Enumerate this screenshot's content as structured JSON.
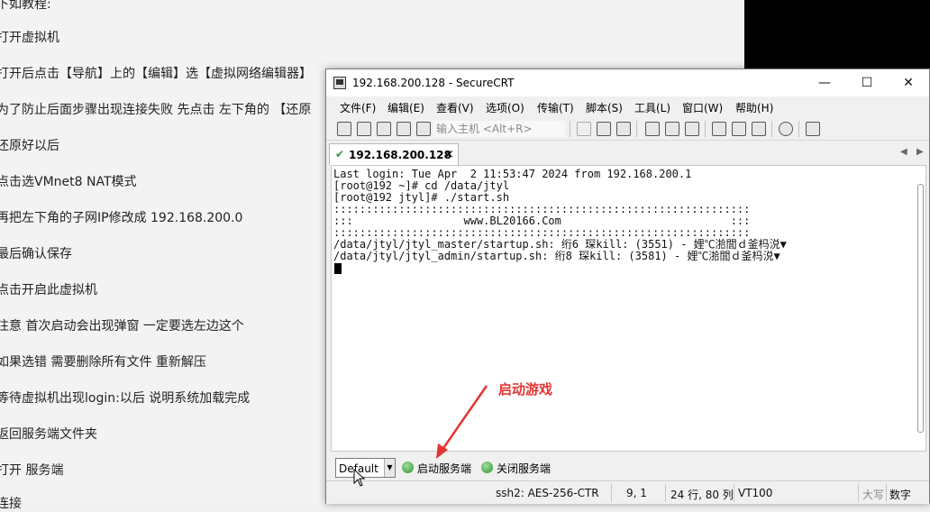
{
  "document": {
    "lines": [
      "打开虚拟机",
      "打开后点击【导航】上的【编辑】选【虚拟网络编辑器】",
      "为了防止后面步骤出现连接失败  先点击 左下角的 【还原",
      "还原好以后",
      "点击选VMnet8 NAT模式",
      "再把左下角的子网IP修改成 192.168.200.0",
      "最后确认保存",
      "点击开启此虚拟机",
      "注意 首次启动会出现弹窗 一定要选左边这个",
      "如果选错 需要删除所有文件 重新解压",
      "等待虚拟机出现login:以后 说明系统加载完成",
      "返回服务端文件夹",
      "打开 服务端",
      "连接"
    ],
    "top_partial": "下如教程:"
  },
  "window": {
    "title": "192.168.200.128 - SecureCRT",
    "min_glyph": "—",
    "max_glyph": "☐",
    "close_glyph": "✕"
  },
  "menu": [
    "文件(F)",
    "编辑(E)",
    "查看(V)",
    "选项(O)",
    "传输(T)",
    "脚本(S)",
    "工具(L)",
    "窗口(W)",
    "帮助(H)"
  ],
  "toolbar": {
    "host_placeholder": "输入主机 <Alt+R>"
  },
  "tab": {
    "label": "192.168.200.128",
    "close": "×"
  },
  "terminal": {
    "lines": [
      "Last login: Tue Apr  2 11:53:47 2024 from 192.168.200.1",
      "[root@192 ~]# cd /data/jtyl",
      "[root@192 jtyl]# ./start.sh",
      "::::::::::::::::::::::::::::::::::::::::::::::::::::::::::::::::",
      ":::                 www.BL20166.Com                          :::",
      "::::::::::::::::::::::::::::::::::::::::::::::::::::::::::::::::",
      "/data/jtyl/jtyl_master/startup.sh: 绗6 琛kill: (3551) - 娌℃湁閭ｄ釜杩涚▼",
      "/data/jtyl/jtyl_admin/startup.sh: 绗8 琛kill: (3581) - 娌℃湁閭ｄ釜杩涚▼"
    ]
  },
  "buttonbar": {
    "session": "Default",
    "start_label": "启动服务端",
    "stop_label": "关闭服务端"
  },
  "annotation": {
    "text": "启动游戏",
    "color": "#e53333"
  },
  "status": {
    "ssh": "ssh2: AES-256-CTR",
    "pos": "9,   1",
    "size": "24 行, 80 列",
    "term": "VT100",
    "caps": "大写",
    "num": "数字"
  }
}
